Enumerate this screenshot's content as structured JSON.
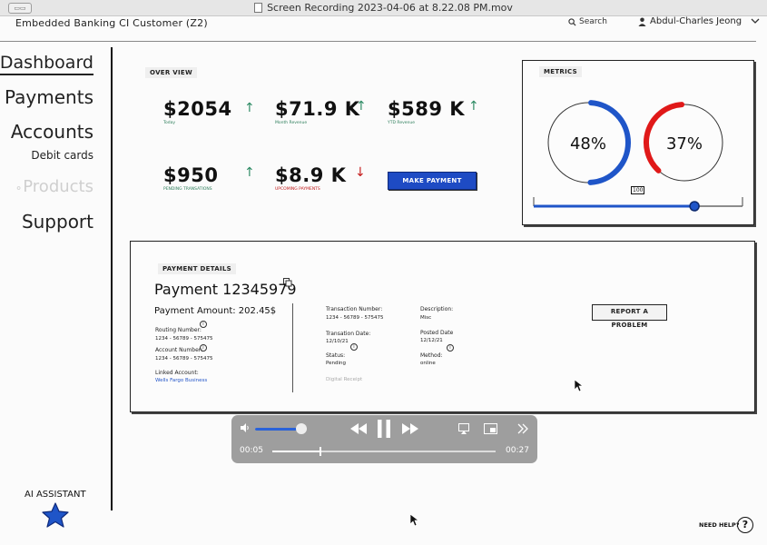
{
  "window": {
    "title": "Screen Recording 2023-04-06 at 8.22.08 PM.mov"
  },
  "header": {
    "brand": "Embedded Banking CI Customer (Z2)",
    "search_label": "Search",
    "user_name": "Abdul-Charles Jeong"
  },
  "sidebar": {
    "items": [
      {
        "label": "Dashboard"
      },
      {
        "label": "Payments"
      },
      {
        "label": "Accounts"
      },
      {
        "label": "Debit cards"
      },
      {
        "label": "Products"
      },
      {
        "label": "Support"
      }
    ],
    "ai_assistant_label": "AI ASSISTANT"
  },
  "overview": {
    "tag": "OVER VIEW",
    "metrics": [
      {
        "value": "$2054",
        "label": "Today",
        "trend": "up"
      },
      {
        "value": "$71.9 K",
        "label": "Month Revenue",
        "trend": "up"
      },
      {
        "value": "$589 K",
        "label": "YTD Revenue",
        "trend": "up"
      },
      {
        "value": "$950",
        "label": "PENDING TRANSATIONS",
        "trend": "up"
      },
      {
        "value": "$8.9 K",
        "label": "UPCOMING PAYMENTS",
        "trend": "down"
      }
    ],
    "make_payment_label": "MAKE PAYMENT"
  },
  "metrics_card": {
    "tag": "METRICS",
    "gauges": [
      {
        "text": "48%",
        "value": 48,
        "color": "#1f55c8"
      },
      {
        "text": "37%",
        "value": 37,
        "color": "#e01919"
      }
    ],
    "slider_value": "100",
    "slider_fraction": 0.77
  },
  "payment_details": {
    "tag": "PAYMENT DETAILS",
    "title": "Payment 12345979",
    "amount": "Payment Amount: 202.45$",
    "routing_label": "Routing Number:",
    "routing_value": "1234 - 56789 - 575475",
    "account_label": "Account Number:",
    "account_value": "1234 - 56789 - 575475",
    "linked_label": "Linked Account:",
    "linked_value": "Wells Fargo Business",
    "txn_number_label": "Transaction Number:",
    "txn_number_value": "1234 - 56789 - 575475",
    "txn_date_label": "Transation Date:",
    "txn_date_value": "12/10/21",
    "status_label": "Status:",
    "status_value": "Pending",
    "receipt_label": "Digital Receipt",
    "description_label": "Description:",
    "description_value": "Misc",
    "posted_label": "Posted Date",
    "posted_value": "12/12/21",
    "method_label": "Method:",
    "method_value": "online",
    "report_label": "REPORT A PROBLEM"
  },
  "player": {
    "elapsed": "00:05",
    "remaining": "00:27",
    "volume_fraction": 0.9,
    "progress_fraction": 0.21
  },
  "help": {
    "label": "NEED HELP?",
    "icon_text": "?"
  }
}
